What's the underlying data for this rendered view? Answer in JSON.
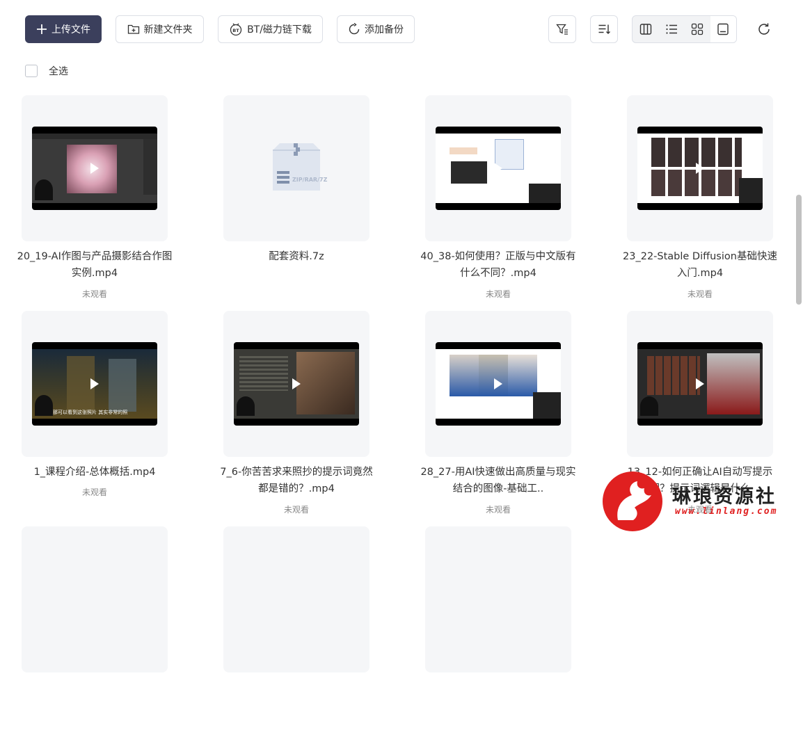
{
  "toolbar": {
    "upload_label": "上传文件",
    "new_folder_label": "新建文件夹",
    "bt_label": "BT/磁力链下载",
    "backup_label": "添加备份"
  },
  "select_all_label": "全选",
  "files": [
    {
      "name": "20_19-AI作图与产品摄影结合作图实例.mp4",
      "status": "未观看",
      "type": "video"
    },
    {
      "name": "配套资料.7z",
      "status": "",
      "type": "archive"
    },
    {
      "name": "40_38-如何使用？正版与中文版有什么不同？.mp4",
      "status": "未观看",
      "type": "video"
    },
    {
      "name": "23_22-Stable Diffusion基础快速入门.mp4",
      "status": "未观看",
      "type": "video"
    },
    {
      "name": "1_课程介绍-总体概括.mp4",
      "status": "未观看",
      "type": "video"
    },
    {
      "name": "7_6-你苦苦求来照抄的提示词竟然都是错的？.mp4",
      "status": "未观看",
      "type": "video"
    },
    {
      "name": "28_27-用AI快速做出高质量与现实结合的图像-基础工..",
      "status": "未观看",
      "type": "video"
    },
    {
      "name": "13_12-如何正确让AI自动写提示词？提示词逻辑是什么",
      "status": "未观看",
      "type": "video"
    }
  ],
  "archive_label": "ZIP/RAR/7Z",
  "subtitle_text": "那可以看到这张照片 其实非常的照",
  "watermark": {
    "title": "琳琅资源社",
    "url": "www.linlang.com"
  },
  "colors": {
    "primary": "#3b3f5c",
    "accent": "#e02020"
  }
}
